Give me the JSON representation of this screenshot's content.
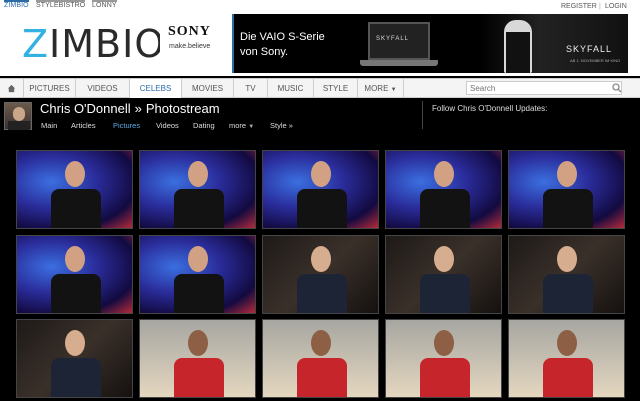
{
  "network": {
    "links": [
      {
        "label": "ZIMBIO",
        "active": true
      },
      {
        "label": "STYLEBISTRO",
        "active": false
      },
      {
        "label": "LONNY",
        "active": false
      }
    ],
    "account": [
      "REGISTER",
      "LOGIN"
    ]
  },
  "logo": {
    "first": "Z",
    "rest": "IMBIO"
  },
  "ad": {
    "brand": "SONY",
    "tagline": "make.believe",
    "headline1": "Die VAIO S-Serie",
    "headline2": "von Sony.",
    "laptop_text": "SKYFALL",
    "movie_title": "SKYFALL",
    "movie_sub": "AB 1. NOVEMBER IM KINO"
  },
  "nav": {
    "tabs": [
      {
        "label": "PICTURES",
        "active": false
      },
      {
        "label": "VIDEOS",
        "active": false
      },
      {
        "label": "CELEBS",
        "active": true
      },
      {
        "label": "MOVIES",
        "active": false
      },
      {
        "label": "TV",
        "active": false
      },
      {
        "label": "MUSIC",
        "active": false
      },
      {
        "label": "STYLE",
        "active": false
      },
      {
        "label": "MORE",
        "active": false
      }
    ],
    "search_placeholder": "Search"
  },
  "profile": {
    "name": "Chris O'Donnell",
    "separator": "»",
    "section": "Photostream",
    "subnav": [
      "Main",
      "Articles",
      "Pictures",
      "Videos",
      "Dating",
      "more",
      "Style »"
    ],
    "active_subnav": "Pictures",
    "follow_text": "Follow Chris O'Donnell Updates:"
  },
  "colors": {
    "accent": "#2a6ca8",
    "logo_z": "#31b2e0",
    "link_active": "#5aa9e6"
  },
  "thumbnails": [
    "stage-blue",
    "stage-blue",
    "stage-blue",
    "stage-blue",
    "stage-blue",
    "stage-blue",
    "stage-blue",
    "party-dark",
    "party-dark",
    "party-dark",
    "party-dark",
    "beach",
    "beach",
    "beach",
    "beach"
  ]
}
